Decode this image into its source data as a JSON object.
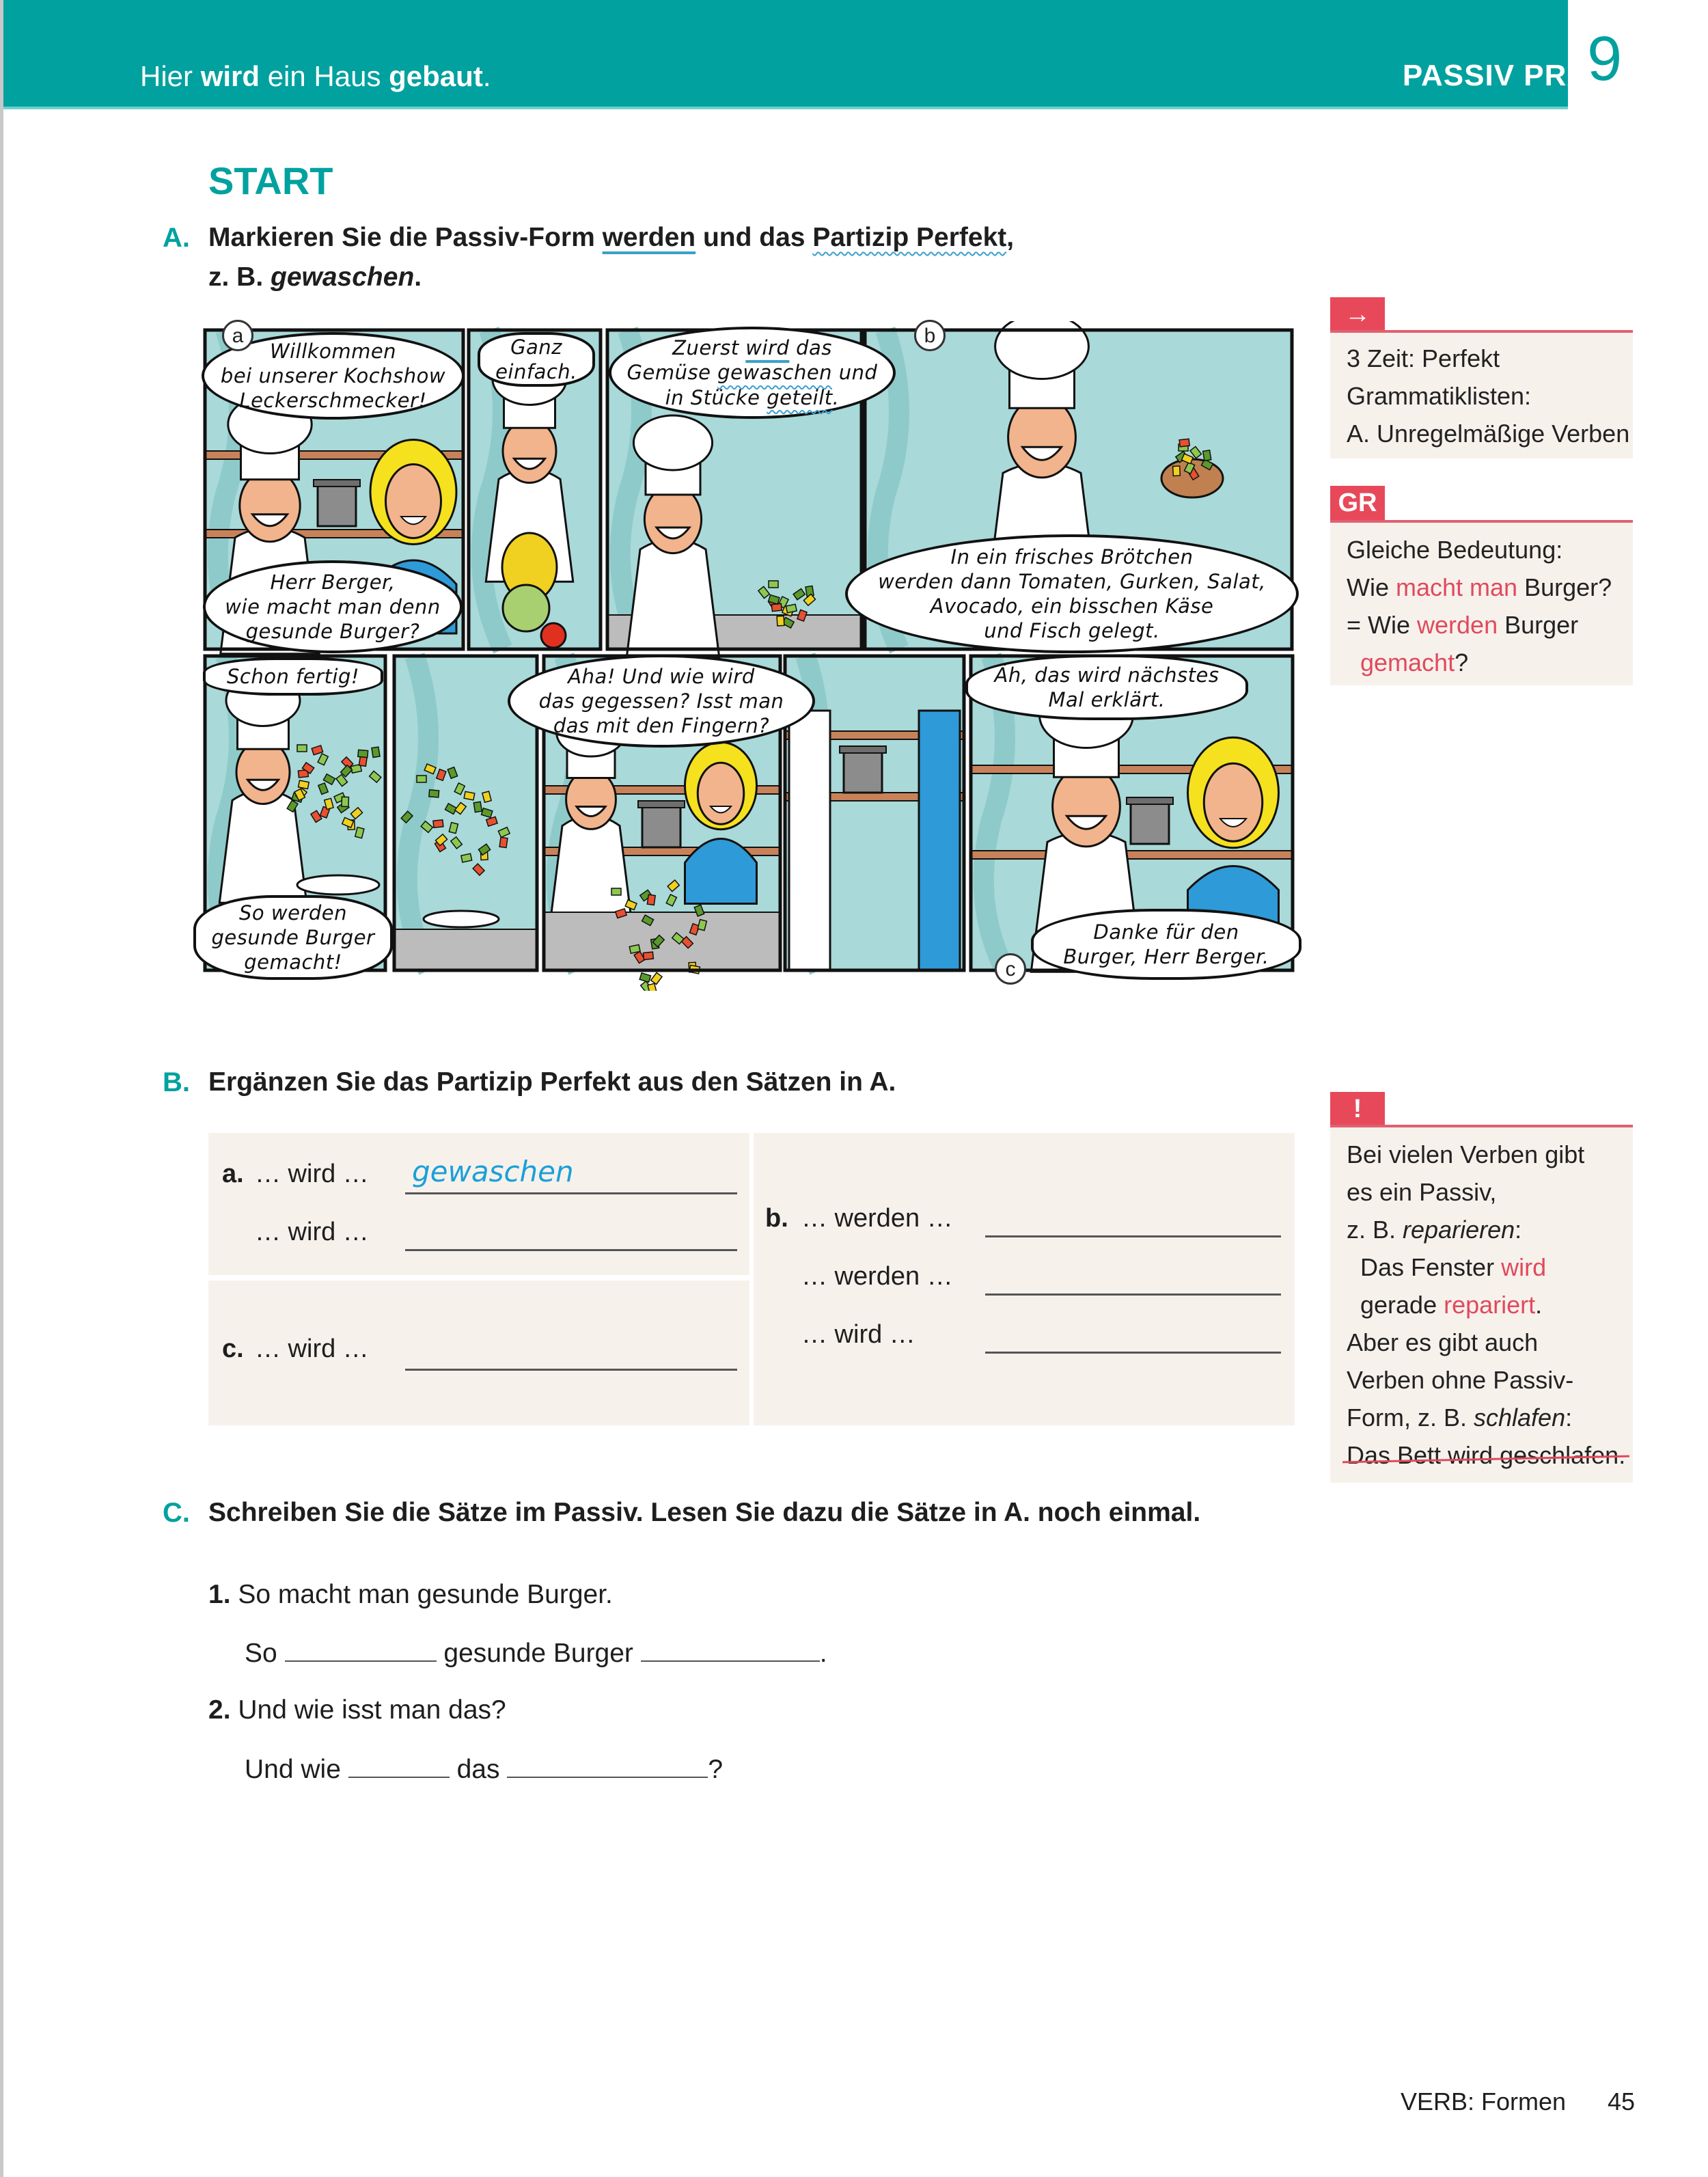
{
  "header": {
    "subtitle_parts": [
      "Hier ",
      "wird",
      " ein Haus ",
      "gebaut",
      "."
    ],
    "title": "PASSIV PRÄSENS",
    "chapter_number": "9",
    "brand_color": "#00a19f"
  },
  "start_label": "START",
  "exercise_a": {
    "label": "A.",
    "line1_parts": [
      "Markieren Sie die Passiv-Form ",
      "werden",
      " und das ",
      "Partizip Perfekt",
      ","
    ],
    "line2_prefix": "z. B. ",
    "line2_example": "gewaschen",
    "line2_suffix": "."
  },
  "comic": {
    "panel_labels": [
      "a",
      "b",
      "c"
    ],
    "bubbles": {
      "welcome": [
        "Willkommen",
        "bei unserer Kochshow",
        "Leckerschmecker!"
      ],
      "question": [
        "Herr Berger,",
        "wie macht man denn",
        "gesunde Burger?"
      ],
      "simple": [
        "Ganz",
        "einfach."
      ],
      "first": {
        "line1": [
          "Zuerst ",
          "wird",
          " das"
        ],
        "line2": [
          "Gemüse ",
          "gewaschen",
          " und"
        ],
        "line3": [
          "in Stücke ",
          "geteilt",
          "."
        ]
      },
      "bun": [
        "In ein frisches Brötchen",
        "werden dann Tomaten, Gurken, Salat,",
        "Avocado, ein bisschen Käse",
        "und Fisch gelegt."
      ],
      "done": [
        "Schon fertig!"
      ],
      "made": [
        "So werden",
        "gesunde Burger",
        "gemacht!"
      ],
      "eat": [
        "Aha! Und wie wird",
        "das gegessen? Isst man",
        "das mit den Fingern?"
      ],
      "next": [
        "Äh, das wird nächstes",
        "Mal erklärt."
      ],
      "thanks": [
        "Danke für den",
        "Burger, Herr Berger."
      ]
    }
  },
  "sidebar": {
    "accent_color": "#e8495a",
    "reference": {
      "icon": "arrow-right-icon",
      "lines": [
        "3 Zeit: Perfekt",
        "Grammatiklisten:",
        "A. Unregelmäßige Verben"
      ]
    },
    "grammar": {
      "tab": "GR",
      "line1": "Gleiche Bedeutung:",
      "line2": [
        "Wie ",
        "macht man",
        " Burger?"
      ],
      "line3": [
        "= Wie ",
        "werden",
        " Burger"
      ],
      "line4": [
        "gemacht",
        "?"
      ]
    },
    "note": {
      "tab": "!",
      "l1": "Bei vielen Verben gibt",
      "l2": "es ein Passiv,",
      "l3": [
        "z. B. ",
        "reparieren",
        ":"
      ],
      "l4": [
        "Das Fenster ",
        "wird"
      ],
      "l5": [
        "gerade ",
        "repariert",
        "."
      ],
      "l6": "Aber es gibt auch",
      "l7": "Verben ohne Passiv-",
      "l8": [
        "Form, z. B. ",
        "schlafen",
        ":"
      ],
      "l9": "Das Bett wird geschlafen."
    }
  },
  "exercise_b": {
    "label": "B.",
    "instruction": "Ergänzen Sie das Partizip Perfekt aus den Sätzen in A.",
    "a_label": "a.",
    "a_rows": [
      "… wird …",
      "… wird …"
    ],
    "a_answer": "gewaschen",
    "b_label": "b.",
    "b_rows": [
      "… werden …",
      "… werden …",
      "… wird …"
    ],
    "c_label": "c.",
    "c_rows": [
      "… wird …"
    ]
  },
  "exercise_c": {
    "label": "C.",
    "instruction": "Schreiben Sie die Sätze im Passiv. Lesen Sie dazu die Sätze in A. noch einmal.",
    "items": [
      {
        "num": "1.",
        "sentence": "So macht man gesunde Burger.",
        "parts": [
          "So",
          "gesunde Burger",
          "."
        ]
      },
      {
        "num": "2.",
        "sentence": "Und wie isst man das?",
        "parts": [
          "Und wie",
          "das",
          "?"
        ]
      }
    ]
  },
  "footer": {
    "section": "VERB: Formen",
    "page": "45"
  }
}
